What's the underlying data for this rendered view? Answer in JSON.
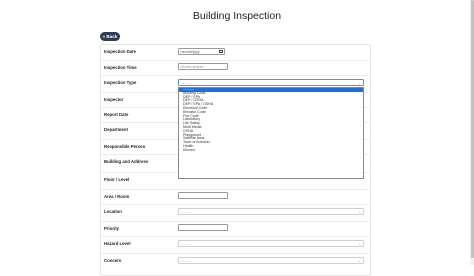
{
  "page": {
    "title": "Building Inspection",
    "back_label": "« Back"
  },
  "form": {
    "rows": [
      {
        "label": "Inspection Date"
      },
      {
        "label": "Inspection Time"
      },
      {
        "label": "Inspection Type"
      },
      {
        "label": "Inspector"
      },
      {
        "label": "Report Date"
      },
      {
        "label": "Department"
      },
      {
        "label": "Responsible Person"
      },
      {
        "label": "Building and Address"
      },
      {
        "label": "Floor / Level"
      },
      {
        "label": "Area / Room"
      },
      {
        "label": "Location"
      },
      {
        "label": "Priority"
      },
      {
        "label": "Hazard Level"
      },
      {
        "label": "Concern"
      }
    ],
    "date_placeholder": "mm/dd/yyyy",
    "time_placeholder": "hh:mm am/pm",
    "select_placeholder": "---------",
    "inspection_type": {
      "value": "---------",
      "options": [
        "---------",
        "Building Code",
        "DEP / EPA",
        "DEP / OSHA",
        "DEP / EPA / OSHA",
        "Electrical Code",
        "Elevator Code",
        "Fire Code",
        "Laboratory",
        "Life Safety",
        "Multi Media",
        "OSHA",
        "Playground",
        "Satellite Area",
        "Town of Amherst",
        "Health",
        "Kitchen"
      ]
    }
  }
}
